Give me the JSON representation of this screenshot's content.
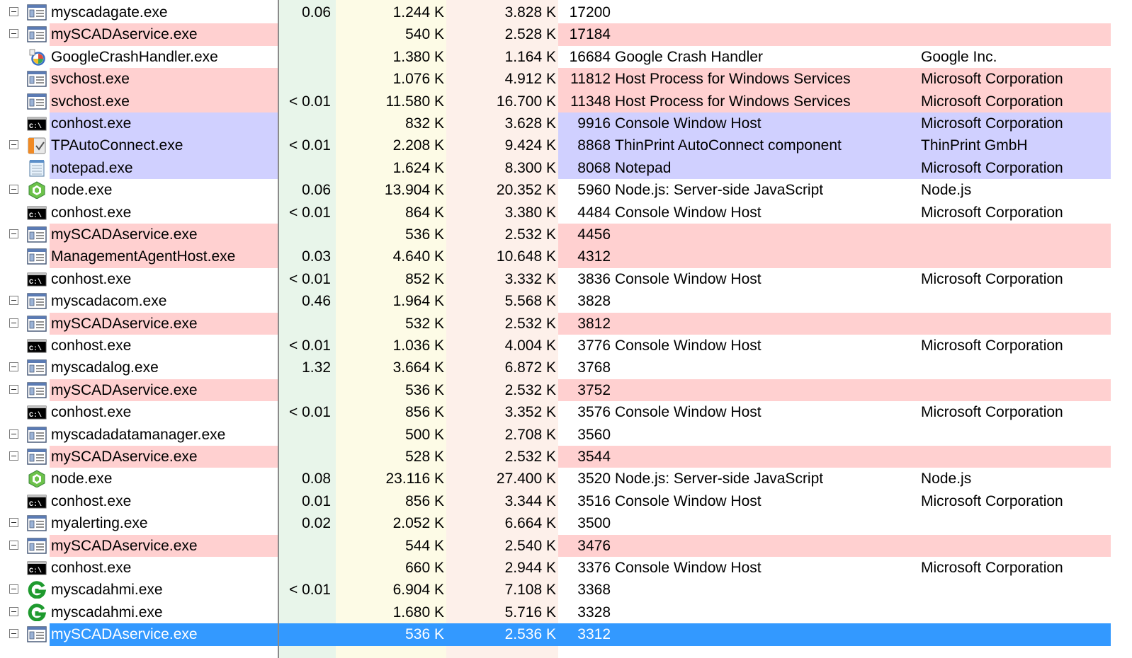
{
  "colors": {
    "cpu_column_bg": "#e8f5ea",
    "private_column_bg": "#fdfbe6",
    "working_set_column_bg": "#fdf0ea",
    "service_row": "#ffd0d0",
    "own_process_row": "#d0d0ff",
    "selected_row": "#3399ff",
    "separator": "#8a8a8a"
  },
  "processes": [
    {
      "name": "myscadagate.exe",
      "cpu": "0.06",
      "private": "1.244 K",
      "working": "3.828 K",
      "pid": "17200",
      "description": "",
      "company": "",
      "icon": "app-window-icon",
      "toggle": true,
      "highlight": "none"
    },
    {
      "name": "mySCADAservice.exe",
      "cpu": "",
      "private": "540 K",
      "working": "2.528 K",
      "pid": "17184",
      "description": "",
      "company": "",
      "icon": "app-window-icon",
      "toggle": true,
      "highlight": "service"
    },
    {
      "name": "GoogleCrashHandler.exe",
      "cpu": "",
      "private": "1.380 K",
      "working": "1.164 K",
      "pid": "16684",
      "description": "Google Crash Handler",
      "company": "Google Inc.",
      "icon": "google-crash-handler-icon",
      "toggle": false,
      "highlight": "none"
    },
    {
      "name": "svchost.exe",
      "cpu": "",
      "private": "1.076 K",
      "working": "4.912 K",
      "pid": "11812",
      "description": "Host Process for Windows Services",
      "company": "Microsoft Corporation",
      "icon": "app-window-icon",
      "toggle": false,
      "highlight": "service"
    },
    {
      "name": "svchost.exe",
      "cpu": "< 0.01",
      "private": "11.580 K",
      "working": "16.700 K",
      "pid": "11348",
      "description": "Host Process for Windows Services",
      "company": "Microsoft Corporation",
      "icon": "app-window-icon",
      "toggle": false,
      "highlight": "service"
    },
    {
      "name": "conhost.exe",
      "cpu": "",
      "private": "832 K",
      "working": "3.628 K",
      "pid": "9916",
      "description": "Console Window Host",
      "company": "Microsoft Corporation",
      "icon": "console-icon",
      "toggle": false,
      "highlight": "own"
    },
    {
      "name": "TPAutoConnect.exe",
      "cpu": "< 0.01",
      "private": "2.208 K",
      "working": "9.424 K",
      "pid": "8868",
      "description": "ThinPrint AutoConnect component",
      "company": "ThinPrint GmbH",
      "icon": "thinprint-icon",
      "toggle": true,
      "highlight": "own"
    },
    {
      "name": "notepad.exe",
      "cpu": "",
      "private": "1.624 K",
      "working": "8.300 K",
      "pid": "8068",
      "description": "Notepad",
      "company": "Microsoft Corporation",
      "icon": "notepad-icon",
      "toggle": false,
      "highlight": "own"
    },
    {
      "name": "node.exe",
      "cpu": "0.06",
      "private": "13.904 K",
      "working": "20.352 K",
      "pid": "5960",
      "description": "Node.js: Server-side JavaScript",
      "company": "Node.js",
      "icon": "nodejs-icon",
      "toggle": true,
      "highlight": "none"
    },
    {
      "name": "conhost.exe",
      "cpu": "< 0.01",
      "private": "864 K",
      "working": "3.380 K",
      "pid": "4484",
      "description": "Console Window Host",
      "company": "Microsoft Corporation",
      "icon": "console-icon",
      "toggle": false,
      "highlight": "none"
    },
    {
      "name": "mySCADAservice.exe",
      "cpu": "",
      "private": "536 K",
      "working": "2.532 K",
      "pid": "4456",
      "description": "",
      "company": "",
      "icon": "app-window-icon",
      "toggle": true,
      "highlight": "service"
    },
    {
      "name": "ManagementAgentHost.exe",
      "cpu": "0.03",
      "private": "4.640 K",
      "working": "10.648 K",
      "pid": "4312",
      "description": "",
      "company": "",
      "icon": "app-window-icon",
      "toggle": false,
      "highlight": "service"
    },
    {
      "name": "conhost.exe",
      "cpu": "< 0.01",
      "private": "852 K",
      "working": "3.332 K",
      "pid": "3836",
      "description": "Console Window Host",
      "company": "Microsoft Corporation",
      "icon": "console-icon",
      "toggle": false,
      "highlight": "none"
    },
    {
      "name": "myscadacom.exe",
      "cpu": "0.46",
      "private": "1.964 K",
      "working": "5.568 K",
      "pid": "3828",
      "description": "",
      "company": "",
      "icon": "app-window-icon",
      "toggle": true,
      "highlight": "none"
    },
    {
      "name": "mySCADAservice.exe",
      "cpu": "",
      "private": "532 K",
      "working": "2.532 K",
      "pid": "3812",
      "description": "",
      "company": "",
      "icon": "app-window-icon",
      "toggle": true,
      "highlight": "service"
    },
    {
      "name": "conhost.exe",
      "cpu": "< 0.01",
      "private": "1.036 K",
      "working": "4.004 K",
      "pid": "3776",
      "description": "Console Window Host",
      "company": "Microsoft Corporation",
      "icon": "console-icon",
      "toggle": false,
      "highlight": "none"
    },
    {
      "name": "myscadalog.exe",
      "cpu": "1.32",
      "private": "3.664 K",
      "working": "6.872 K",
      "pid": "3768",
      "description": "",
      "company": "",
      "icon": "app-window-icon",
      "toggle": true,
      "highlight": "none"
    },
    {
      "name": "mySCADAservice.exe",
      "cpu": "",
      "private": "536 K",
      "working": "2.532 K",
      "pid": "3752",
      "description": "",
      "company": "",
      "icon": "app-window-icon",
      "toggle": true,
      "highlight": "service"
    },
    {
      "name": "conhost.exe",
      "cpu": "< 0.01",
      "private": "856 K",
      "working": "3.352 K",
      "pid": "3576",
      "description": "Console Window Host",
      "company": "Microsoft Corporation",
      "icon": "console-icon",
      "toggle": false,
      "highlight": "none"
    },
    {
      "name": "myscadadatamanager.exe",
      "cpu": "",
      "private": "500 K",
      "working": "2.708 K",
      "pid": "3560",
      "description": "",
      "company": "",
      "icon": "app-window-icon",
      "toggle": true,
      "highlight": "none"
    },
    {
      "name": "mySCADAservice.exe",
      "cpu": "",
      "private": "528 K",
      "working": "2.532 K",
      "pid": "3544",
      "description": "",
      "company": "",
      "icon": "app-window-icon",
      "toggle": true,
      "highlight": "service"
    },
    {
      "name": "node.exe",
      "cpu": "0.08",
      "private": "23.116 K",
      "working": "27.400 K",
      "pid": "3520",
      "description": "Node.js: Server-side JavaScript",
      "company": "Node.js",
      "icon": "nodejs-icon",
      "toggle": false,
      "highlight": "none"
    },
    {
      "name": "conhost.exe",
      "cpu": "0.01",
      "private": "856 K",
      "working": "3.344 K",
      "pid": "3516",
      "description": "Console Window Host",
      "company": "Microsoft Corporation",
      "icon": "console-icon",
      "toggle": false,
      "highlight": "none"
    },
    {
      "name": "myalerting.exe",
      "cpu": "0.02",
      "private": "2.052 K",
      "working": "6.664 K",
      "pid": "3500",
      "description": "",
      "company": "",
      "icon": "app-window-icon",
      "toggle": true,
      "highlight": "none"
    },
    {
      "name": "mySCADAservice.exe",
      "cpu": "",
      "private": "544 K",
      "working": "2.540 K",
      "pid": "3476",
      "description": "",
      "company": "",
      "icon": "app-window-icon",
      "toggle": true,
      "highlight": "service"
    },
    {
      "name": "conhost.exe",
      "cpu": "",
      "private": "660 K",
      "working": "2.944 K",
      "pid": "3376",
      "description": "Console Window Host",
      "company": "Microsoft Corporation",
      "icon": "console-icon",
      "toggle": false,
      "highlight": "none"
    },
    {
      "name": "myscadahmi.exe",
      "cpu": "< 0.01",
      "private": "6.904 K",
      "working": "7.108 K",
      "pid": "3368",
      "description": "",
      "company": "",
      "icon": "myscada-g-icon",
      "toggle": true,
      "highlight": "none"
    },
    {
      "name": "myscadahmi.exe",
      "cpu": "",
      "private": "1.680 K",
      "working": "5.716 K",
      "pid": "3328",
      "description": "",
      "company": "",
      "icon": "myscada-g-icon",
      "toggle": true,
      "highlight": "none"
    },
    {
      "name": "mySCADAservice.exe",
      "cpu": "",
      "private": "536 K",
      "working": "2.536 K",
      "pid": "3312",
      "description": "",
      "company": "",
      "icon": "app-window-icon",
      "toggle": true,
      "highlight": "selected"
    }
  ]
}
